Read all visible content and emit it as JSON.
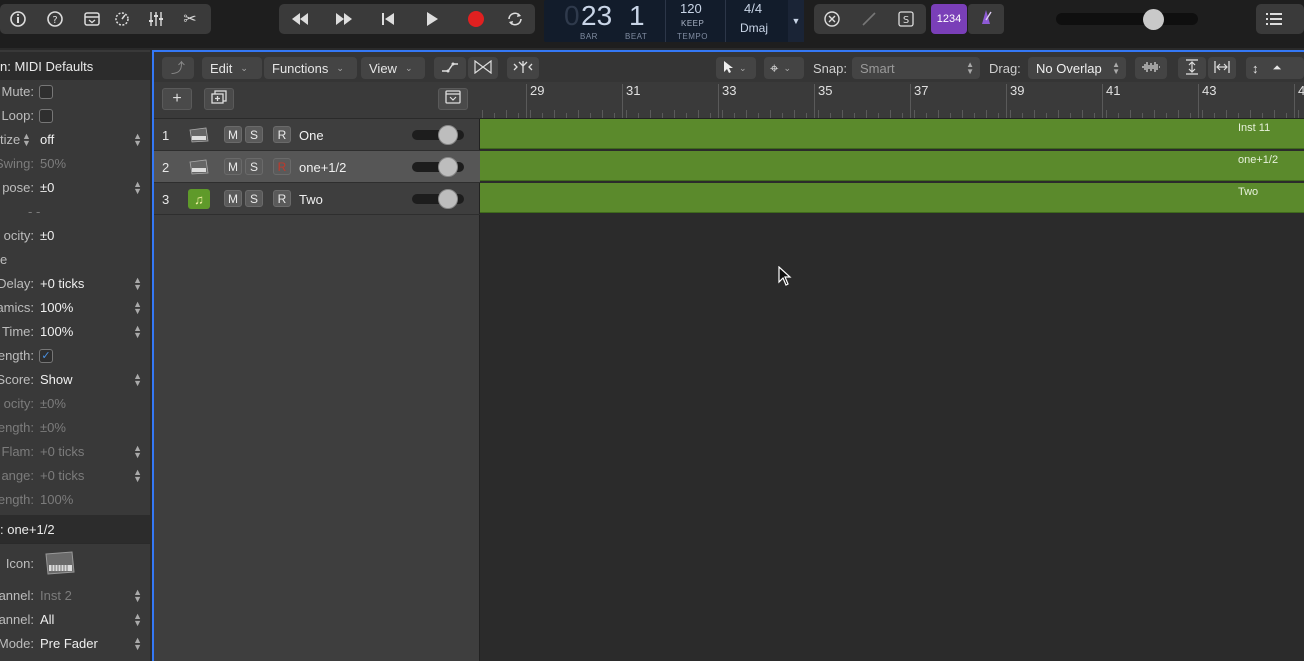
{
  "control_bar": {
    "lcd": {
      "bar_prefix": "0",
      "bar": "23",
      "beat": "1",
      "bar_label": "BAR",
      "beat_label": "BEAT",
      "tempo": "120",
      "tempo_mode": "KEEP",
      "tempo_label": "TEMPO",
      "signature": "4/4",
      "key": "Dmaj"
    },
    "count_in": "1234",
    "icons": [
      "library-icon",
      "help-icon",
      "toolbar-icon",
      "tuner-icon",
      "mixer-icon",
      "scissors-icon",
      "rewind-icon",
      "fast-forward-icon",
      "go-to-start-icon",
      "play-icon",
      "record-icon",
      "cycle-icon",
      "replace-icon",
      "autopunch-icon",
      "solo-icon",
      "metronome-icon",
      "list-editor-icon"
    ]
  },
  "inspector": {
    "region_header": "n: MIDI Defaults",
    "params": [
      {
        "label": "Mute:",
        "type": "checkbox",
        "checked": false
      },
      {
        "label": "Loop:",
        "type": "checkbox",
        "checked": false
      },
      {
        "label": "tize",
        "value": "off",
        "stepper": true
      },
      {
        "label": "Swing:",
        "value": "50%",
        "dim": true
      },
      {
        "label": "pose:",
        "value": "±0",
        "stepper": true
      },
      {
        "label": "",
        "value": "- -",
        "dim": true
      },
      {
        "label": "ocity:",
        "value": "±0"
      },
      {
        "label": "e",
        "value": ""
      },
      {
        "label": "Delay:",
        "value": "+0 ticks",
        "stepper": true
      },
      {
        "label": "amics:",
        "value": "100%",
        "stepper": true
      },
      {
        "label": "Time:",
        "value": "100%",
        "stepper": true
      },
      {
        "label": "ength:",
        "type": "checkbox",
        "checked": true
      },
      {
        "label": "Score:",
        "value": "Show",
        "stepper": true
      },
      {
        "label": "ocity:",
        "value": "±0%",
        "dim": true
      },
      {
        "label": "ength:",
        "value": "±0%",
        "dim": true
      },
      {
        "label": "Flam:",
        "value": "+0 ticks",
        "dim": true,
        "stepper": true
      },
      {
        "label": "ange:",
        "value": "+0 ticks",
        "dim": true,
        "stepper": true
      },
      {
        "label": "ength:",
        "value": "100%",
        "dim": true
      }
    ],
    "track_header": ":  one+1/2",
    "track_params": [
      {
        "label": "Icon:",
        "value": ""
      },
      {
        "label": "annel:",
        "value": "Inst 2",
        "dim": true,
        "stepper": true
      },
      {
        "label": "annel:",
        "value": "All",
        "stepper": true
      },
      {
        "label": "Mode:",
        "value": "Pre Fader",
        "stepper": true
      }
    ]
  },
  "local_bar": {
    "menus": [
      "Edit",
      "Functions",
      "View"
    ],
    "snap_label": "Snap:",
    "snap_value": "Smart",
    "drag_label": "Drag:",
    "drag_value": "No Overlap"
  },
  "ruler": {
    "bars": [
      "29",
      "31",
      "33",
      "35",
      "37",
      "39",
      "41",
      "43",
      "4"
    ]
  },
  "tracks": [
    {
      "num": "1",
      "name": "One",
      "icon": "keyboard-icon",
      "region": "Inst 11",
      "record_red": false,
      "selected": false
    },
    {
      "num": "2",
      "name": "one+1/2",
      "icon": "keyboard-icon",
      "region": "one+1/2",
      "record_red": true,
      "selected": true
    },
    {
      "num": "3",
      "name": "Two",
      "icon": "music-note-icon",
      "region": "Two",
      "record_red": false,
      "selected": false
    }
  ],
  "buttons": {
    "mute": "M",
    "solo": "S",
    "record": "R"
  },
  "colors": {
    "region_green": "#5b8a2c",
    "selection_blue": "#3478f6",
    "count_in_purple": "#7a3fb8",
    "record_red": "#e02020"
  }
}
